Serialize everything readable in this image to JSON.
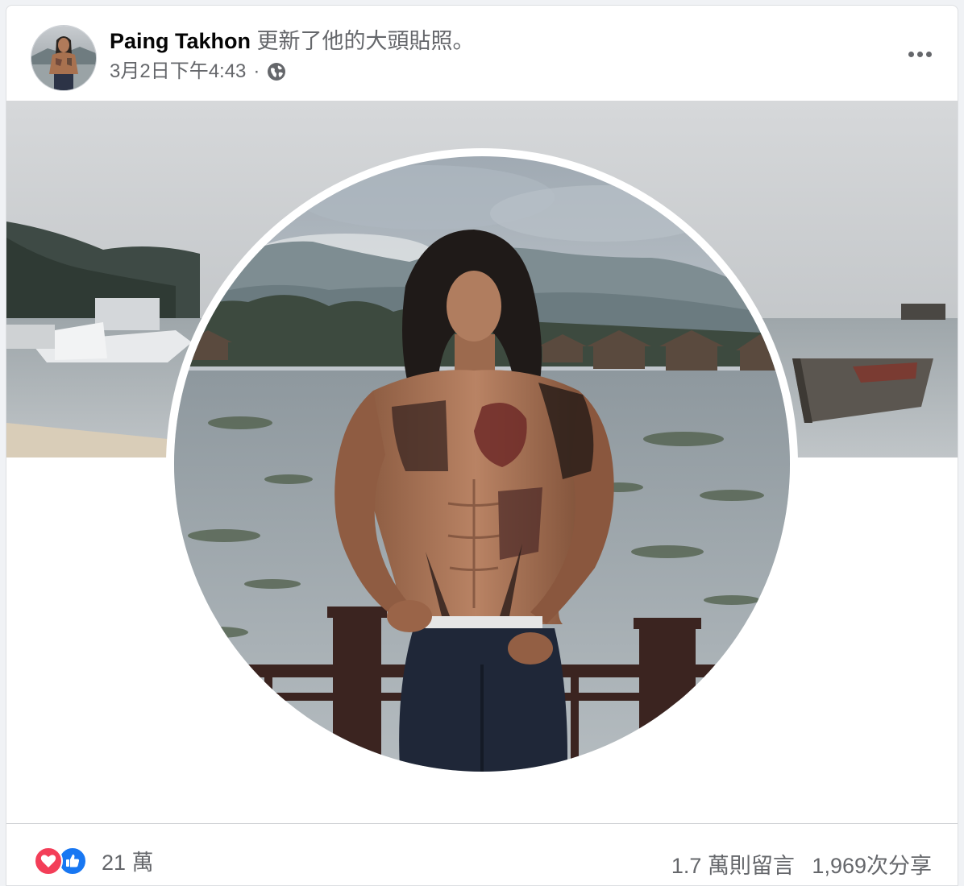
{
  "post": {
    "author": "Paing Takhon",
    "action": "更新了他的大頭貼照。",
    "timestamp": "3月2日下午4:43",
    "separator": "·",
    "privacy_icon": "globe-icon",
    "more_icon": "more-options-icon"
  },
  "photo": {
    "type": "profile-picture-update",
    "subject": "shirtless tattooed man with long hair by a lake",
    "ring_color": "#ffffff"
  },
  "footer": {
    "reaction_icons": [
      "love-icon",
      "like-icon"
    ],
    "reaction_count": "21 萬",
    "comments": "1.7 萬則留言",
    "shares": "1,969次分享"
  },
  "colors": {
    "love": "#f33e58",
    "like": "#1877f2",
    "secondary_text": "#65676b",
    "primary_text": "#050505"
  }
}
